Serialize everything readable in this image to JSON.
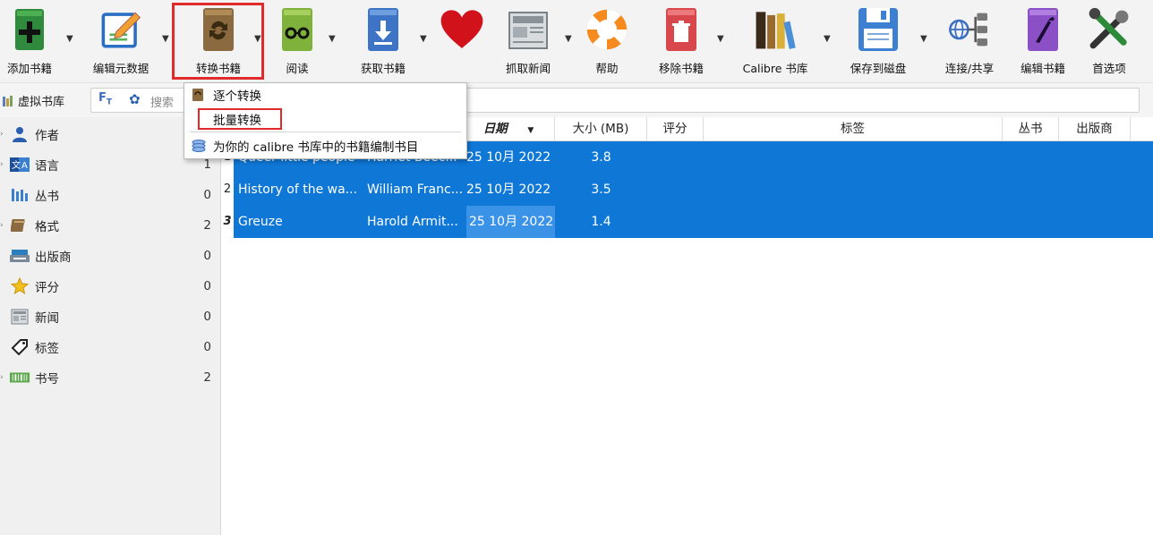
{
  "toolbar": {
    "buttons": [
      {
        "label": "添加书籍",
        "icon": "add-book-icon"
      },
      {
        "label": "编辑元数据",
        "icon": "edit-metadata-icon"
      },
      {
        "label": "转换书籍",
        "icon": "convert-book-icon"
      },
      {
        "label": "阅读",
        "icon": "read-icon"
      },
      {
        "label": "获取书籍",
        "icon": "get-books-icon"
      },
      {
        "label": "",
        "icon": "heart-icon"
      },
      {
        "label": "抓取新闻",
        "icon": "fetch-news-icon"
      },
      {
        "label": "帮助",
        "icon": "help-icon"
      },
      {
        "label": "移除书籍",
        "icon": "remove-books-icon"
      },
      {
        "label": "Calibre 书库",
        "icon": "calibre-library-icon"
      },
      {
        "label": "保存到磁盘",
        "icon": "save-to-disk-icon"
      },
      {
        "label": "连接/共享",
        "icon": "connect-share-icon"
      },
      {
        "label": "编辑书籍",
        "icon": "edit-book-icon"
      },
      {
        "label": "首选项",
        "icon": "preferences-icon"
      }
    ]
  },
  "search": {
    "virtual_library": "虚拟书库",
    "placeholder": "搜索"
  },
  "menu": {
    "items": [
      "逐个转换",
      "批量转换",
      "为你的 calibre 书库中的书籍编制书目"
    ]
  },
  "sidebar": {
    "items": [
      {
        "label": "作者",
        "count": ""
      },
      {
        "label": "语言",
        "count": "1"
      },
      {
        "label": "丛书",
        "count": "0"
      },
      {
        "label": "格式",
        "count": "2"
      },
      {
        "label": "出版商",
        "count": "0"
      },
      {
        "label": "评分",
        "count": "0"
      },
      {
        "label": "新闻",
        "count": "0"
      },
      {
        "label": "标签",
        "count": "0"
      },
      {
        "label": "书号",
        "count": "2"
      }
    ]
  },
  "table": {
    "columns": [
      "日期",
      "大小 (MB)",
      "评分",
      "标签",
      "丛书",
      "出版商"
    ],
    "rows": [
      {
        "num": "1",
        "title": "Queer little people",
        "author": "Harriet Beec...",
        "date": "25 10月 2022",
        "size": "3.8"
      },
      {
        "num": "2",
        "title": "History of the wa...",
        "author": "William Franc...",
        "date": "25 10月 2022",
        "size": "3.5"
      },
      {
        "num": "3",
        "title": "Greuze",
        "author": "Harold Armit...",
        "date": "25 10月 2022",
        "size": "1.4"
      }
    ]
  },
  "colors": {
    "selection": "#0f78d7",
    "highlight_box": "#e12a2a"
  }
}
